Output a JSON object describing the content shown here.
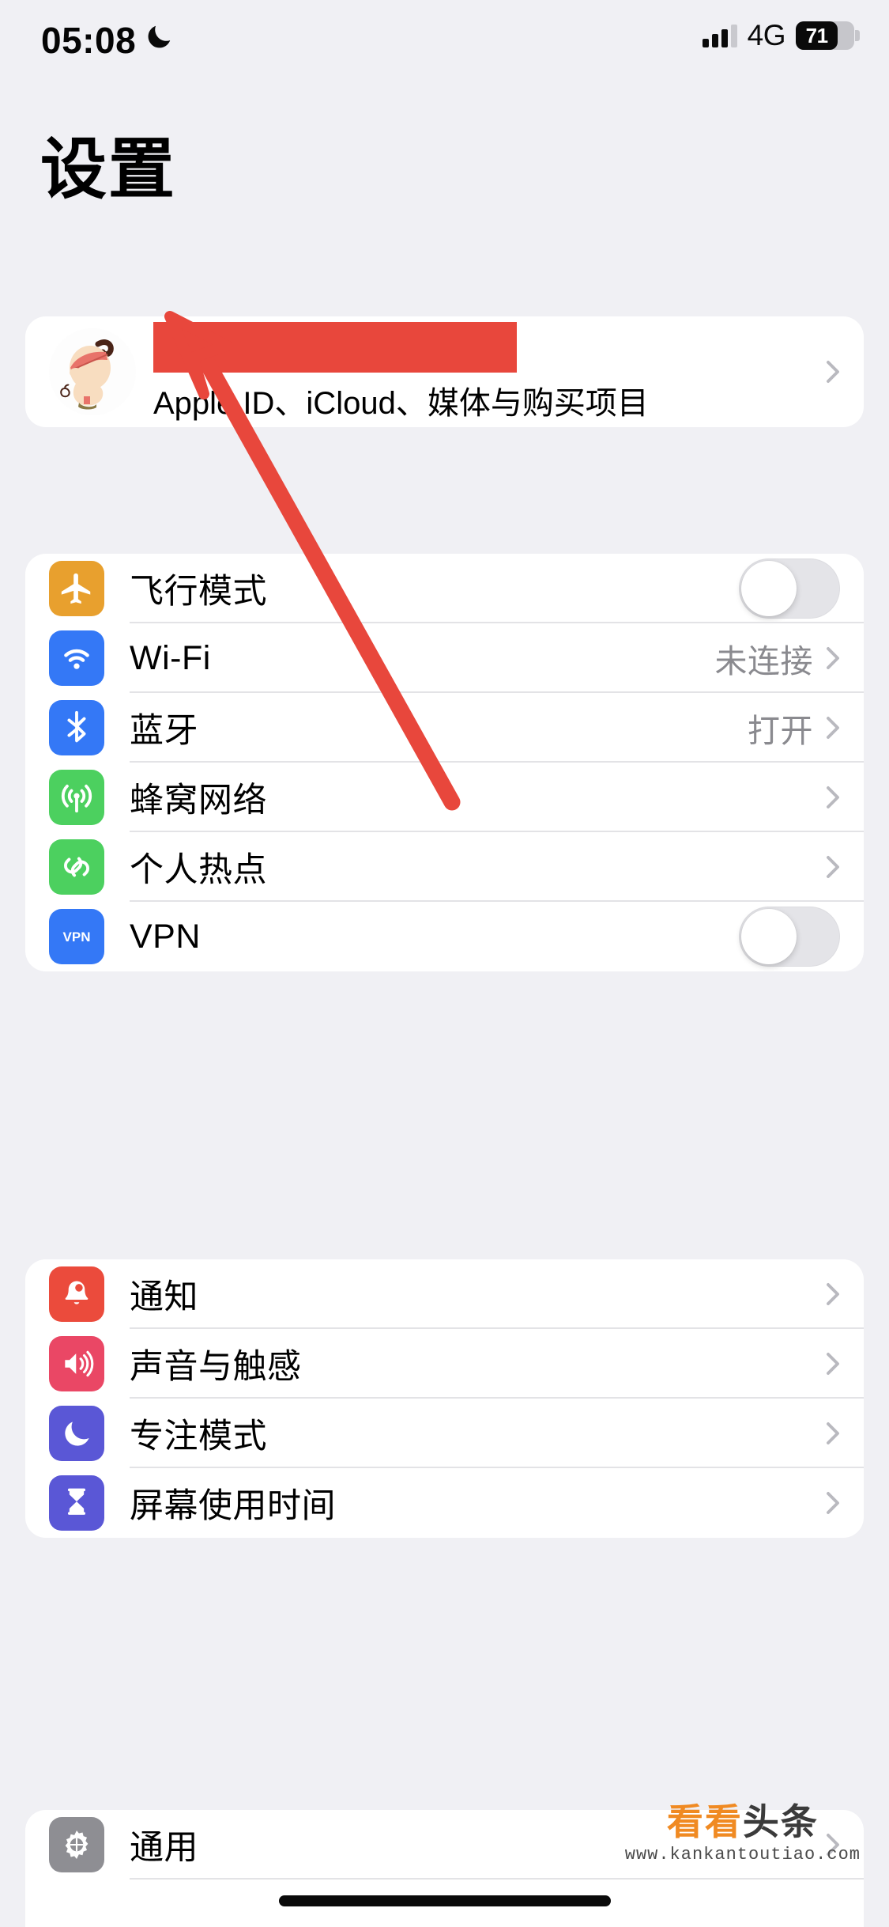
{
  "status_bar": {
    "time": "05:08",
    "moon_icon": "crescent-moon-icon",
    "signal_icon": "cellular-bars-icon",
    "network": "4G",
    "battery_percent": "71",
    "battery_level": 71
  },
  "header": {
    "title": "设置"
  },
  "account": {
    "avatar_icon": "cartoon-avatar",
    "name_redacted": true,
    "subtitle": "Apple ID、iCloud、媒体与购买项目",
    "chevron_icon": "chevron-right-icon"
  },
  "annotation": {
    "type": "red-arrow",
    "color": "#e8473c",
    "points_to": "account-card"
  },
  "groups": [
    {
      "id": "connectivity",
      "rows": [
        {
          "label": "飞行模式",
          "icon": "airplane-icon",
          "icon_color": "#e8a02e",
          "accessory": "toggle",
          "toggle_on": false
        },
        {
          "label": "Wi-Fi",
          "icon": "wifi-icon",
          "icon_color": "#3478f6",
          "accessory": "value",
          "value": "未连接"
        },
        {
          "label": "蓝牙",
          "icon": "bluetooth-icon",
          "icon_color": "#3478f6",
          "accessory": "value",
          "value": "打开"
        },
        {
          "label": "蜂窝网络",
          "icon": "cellular-antenna-icon",
          "icon_color": "#4cd05f",
          "accessory": "chevron",
          "value": ""
        },
        {
          "label": "个人热点",
          "icon": "hotspot-link-icon",
          "icon_color": "#4cd05f",
          "accessory": "chevron",
          "value": ""
        },
        {
          "label": "VPN",
          "icon": "vpn-icon",
          "icon_color": "#3478f6",
          "accessory": "toggle",
          "toggle_on": false
        }
      ]
    },
    {
      "id": "alerts",
      "rows": [
        {
          "label": "通知",
          "icon": "bell-icon",
          "icon_color": "#eb4b3c",
          "accessory": "chevron",
          "value": ""
        },
        {
          "label": "声音与触感",
          "icon": "speaker-icon",
          "icon_color": "#ea4765",
          "accessory": "chevron",
          "value": ""
        },
        {
          "label": "专注模式",
          "icon": "moon-icon",
          "icon_color": "#5a57d6",
          "accessory": "chevron",
          "value": ""
        },
        {
          "label": "屏幕使用时间",
          "icon": "hourglass-icon",
          "icon_color": "#5a57d6",
          "accessory": "chevron",
          "value": ""
        }
      ]
    },
    {
      "id": "system",
      "rows": [
        {
          "label": "通用",
          "icon": "gear-icon",
          "icon_color": "#8e8e93",
          "accessory": "chevron",
          "value": ""
        }
      ]
    }
  ],
  "watermark": {
    "brand_orange": "看看",
    "brand_dark": "头条",
    "url": "www.kankantoutiao.com"
  },
  "colors": {
    "page_background": "#f0f0f4",
    "card_background": "#ffffff",
    "separator": "#e3e3e6",
    "secondary_text": "#8a8a8f",
    "accent_red": "#e8473c"
  }
}
